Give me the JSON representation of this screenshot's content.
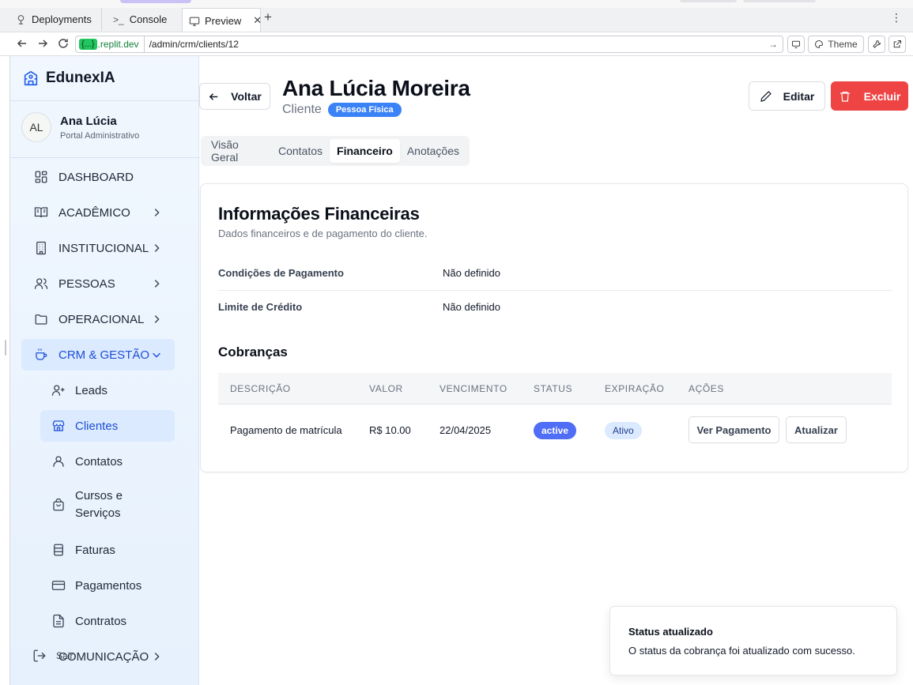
{
  "browser": {
    "tabs": [
      {
        "label": "Deployments"
      },
      {
        "label": "Console"
      },
      {
        "label": "Preview"
      }
    ],
    "address": {
      "host_tag": "{...}",
      "host": ".replit.dev",
      "path": "/admin/crm/clients/12"
    },
    "theme_label": "Theme"
  },
  "sidebar": {
    "brand": "EdunexIA",
    "user": {
      "initials": "AL",
      "name": "Ana Lúcia",
      "role": "Portal Administrativo"
    },
    "items": [
      {
        "label": "DASHBOARD",
        "icon": "dashboard-icon"
      },
      {
        "label": "ACADÊMICO",
        "icon": "book-open-icon"
      },
      {
        "label": "INSTITUCIONAL",
        "icon": "building-icon"
      },
      {
        "label": "PESSOAS",
        "icon": "users-icon"
      },
      {
        "label": "OPERACIONAL",
        "icon": "folder-icon"
      },
      {
        "label": "CRM & GESTÃO",
        "icon": "coffee-icon"
      }
    ],
    "subitems": [
      {
        "label": "Leads",
        "icon": "user-plus-icon"
      },
      {
        "label": "Clientes",
        "icon": "store-icon"
      },
      {
        "label": "Contatos",
        "icon": "user-icon"
      },
      {
        "label": "Cursos e Serviços",
        "icon": "shopping-bag-icon"
      },
      {
        "label": "Faturas",
        "icon": "receipt-icon"
      },
      {
        "label": "Pagamentos",
        "icon": "credit-card-icon"
      },
      {
        "label": "Contratos",
        "icon": "file-text-icon"
      }
    ],
    "comm_label": "COMUNICAÇÃO",
    "logout_label": "Sair"
  },
  "header": {
    "back_label": "Voltar",
    "title": "Ana Lúcia Moreira",
    "subtitle": "Cliente",
    "type_badge": "Pessoa Física",
    "edit_label": "Editar",
    "delete_label": "Excluir"
  },
  "tabs": [
    {
      "label": "Visão Geral"
    },
    {
      "label": "Contatos"
    },
    {
      "label": "Financeiro"
    },
    {
      "label": "Anotações"
    }
  ],
  "finance": {
    "title": "Informações Financeiras",
    "description": "Dados financeiros e de pagamento do cliente.",
    "rows": [
      {
        "label": "Condições de Pagamento",
        "value": "Não definido"
      },
      {
        "label": "Limite de Crédito",
        "value": "Não definido"
      }
    ],
    "charges_title": "Cobranças",
    "table": {
      "headers": [
        "DESCRIÇÃO",
        "VALOR",
        "VENCIMENTO",
        "STATUS",
        "EXPIRAÇÃO",
        "AÇÕES"
      ],
      "rows": [
        {
          "description": "Pagamento de matrícula",
          "value": "R$ 10.00",
          "due": "22/04/2025",
          "status": "active",
          "expiration": "Ativo",
          "action_view": "Ver Pagamento",
          "action_update": "Atualizar"
        }
      ]
    }
  },
  "toast": {
    "title": "Status atualizado",
    "message": "O status da cobrança foi atualizado com sucesso."
  },
  "colors": {
    "primary": "#3b82f6",
    "danger": "#ef4444",
    "sidebar_active_bg": "#dbeafe",
    "sidebar_active_text": "#1d4ed8"
  }
}
